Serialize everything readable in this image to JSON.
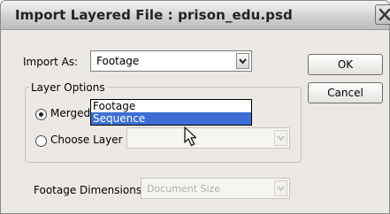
{
  "window": {
    "title": "Import Layered File : prison_edu.psd"
  },
  "import_as": {
    "label": "Import As:",
    "value": "Footage",
    "options": [
      "Footage",
      "Sequence"
    ],
    "highlighted": "Sequence"
  },
  "layer_options": {
    "label": "Layer Options",
    "merged_label": "Merged Layers",
    "choose_label": "Choose Layer",
    "merged_selected": true
  },
  "footage_dimensions": {
    "label": "Footage Dimensions:",
    "value": "Document Size"
  },
  "buttons": {
    "ok": "OK",
    "cancel": "Cancel"
  },
  "icons": {
    "close": "close-icon",
    "arrow": "chevron-down-icon",
    "cursor": "mouse-pointer-icon"
  },
  "colors": {
    "highlight": "#3d6ed6",
    "dialog_bg": "#ece9e4"
  }
}
